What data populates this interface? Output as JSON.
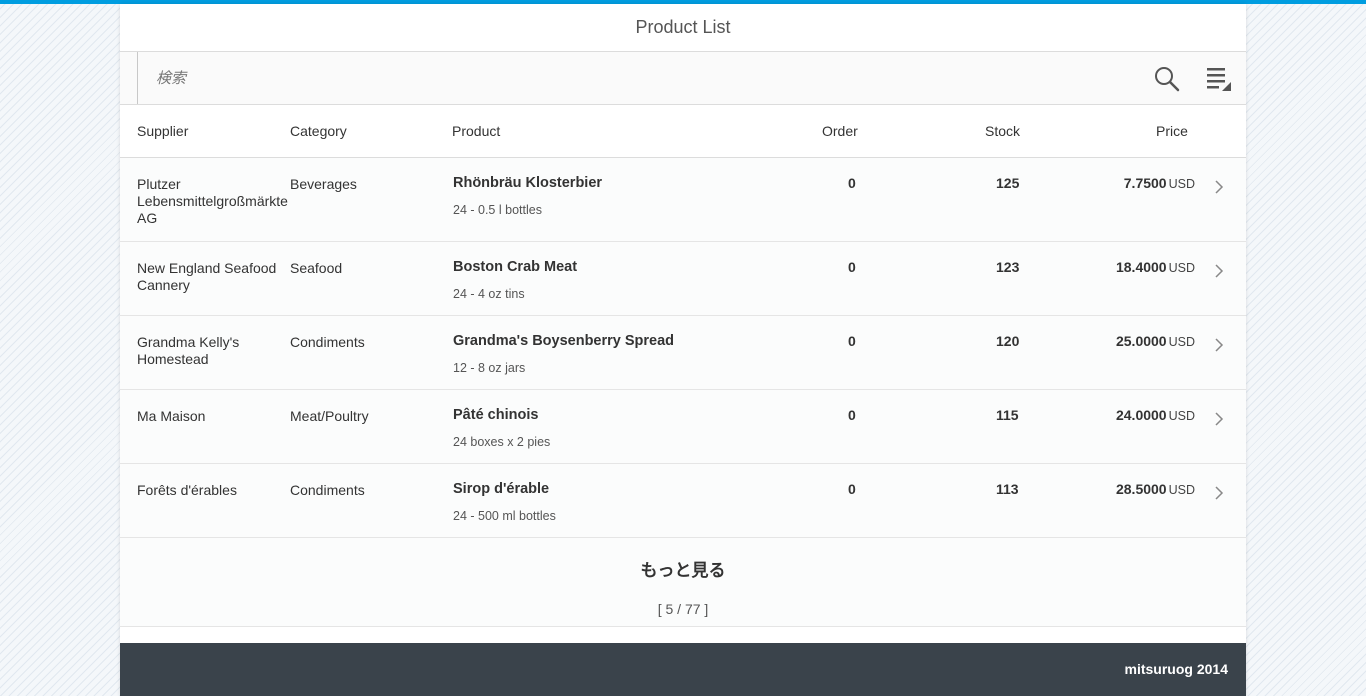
{
  "header": {
    "title": "Product List"
  },
  "search": {
    "placeholder": "検索"
  },
  "columns": {
    "supplier": "Supplier",
    "category": "Category",
    "product": "Product",
    "order": "Order",
    "stock": "Stock",
    "price": "Price"
  },
  "rows": [
    {
      "supplier": "Plutzer Lebensmittelgroßmärkte AG",
      "category": "Beverages",
      "product": "Rhönbräu Klosterbier",
      "desc": "24 - 0.5 l bottles",
      "order": "0",
      "stock": "125",
      "price": "7.7500",
      "unit": "USD"
    },
    {
      "supplier": "New England Seafood Cannery",
      "category": "Seafood",
      "product": "Boston Crab Meat",
      "desc": "24 - 4 oz tins",
      "order": "0",
      "stock": "123",
      "price": "18.4000",
      "unit": "USD"
    },
    {
      "supplier": "Grandma Kelly's Homestead",
      "category": "Condiments",
      "product": "Grandma's Boysenberry Spread",
      "desc": "12 - 8 oz jars",
      "order": "0",
      "stock": "120",
      "price": "25.0000",
      "unit": "USD"
    },
    {
      "supplier": "Ma Maison",
      "category": "Meat/Poultry",
      "product": "Pâté chinois",
      "desc": "24 boxes x 2 pies",
      "order": "0",
      "stock": "115",
      "price": "24.0000",
      "unit": "USD"
    },
    {
      "supplier": "Forêts d'érables",
      "category": "Condiments",
      "product": "Sirop d'érable",
      "desc": "24 - 500 ml bottles",
      "order": "0",
      "stock": "113",
      "price": "28.5000",
      "unit": "USD"
    }
  ],
  "more": {
    "label": "もっと見る",
    "count": "[ 5 / 77 ]"
  },
  "footer": {
    "text": "mitsuruog 2014"
  },
  "colors": {
    "accent": "#009de0",
    "footer_bg": "#3a434b"
  },
  "icons": {
    "search": "search-icon",
    "menu": "list-menu-icon",
    "row_nav": "chevron-right-icon"
  }
}
